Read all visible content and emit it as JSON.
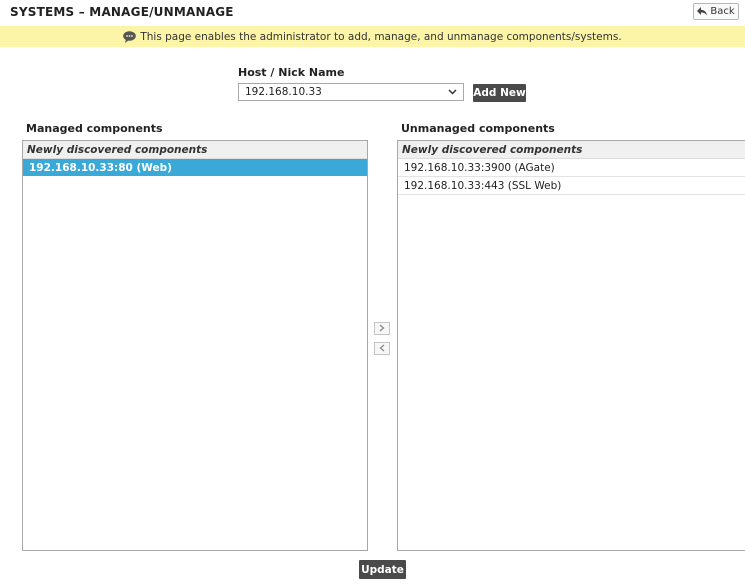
{
  "header": {
    "title": "SYSTEMS – MANAGE/UNMANAGE",
    "back_label": "Back"
  },
  "info": {
    "message": "This page enables the administrator to add, manage, and unmanage components/systems."
  },
  "host": {
    "label": "Host / Nick Name",
    "selected": "192.168.10.33",
    "add_new_label": "Add New"
  },
  "managed": {
    "title": "Managed components",
    "group_header": "Newly discovered components",
    "items": [
      "192.168.10.33:80 (Web)"
    ]
  },
  "unmanaged": {
    "title": "Unmanaged components",
    "group_header": "Newly discovered components",
    "items": [
      "192.168.10.33:3900 (AGate)",
      "192.168.10.33:443 (SSL Web)"
    ]
  },
  "actions": {
    "update_label": "Update"
  },
  "icons": {
    "back": "back-arrow-icon",
    "info": "speech-bubble-icon",
    "dropdown": "chevron-down-icon",
    "move_right": "chevron-right-icon",
    "move_left": "chevron-left-icon"
  },
  "colors": {
    "info_bar": "#fcf5a7",
    "selected_row": "#3ba9d8",
    "dark_button": "#4a4a4a"
  }
}
